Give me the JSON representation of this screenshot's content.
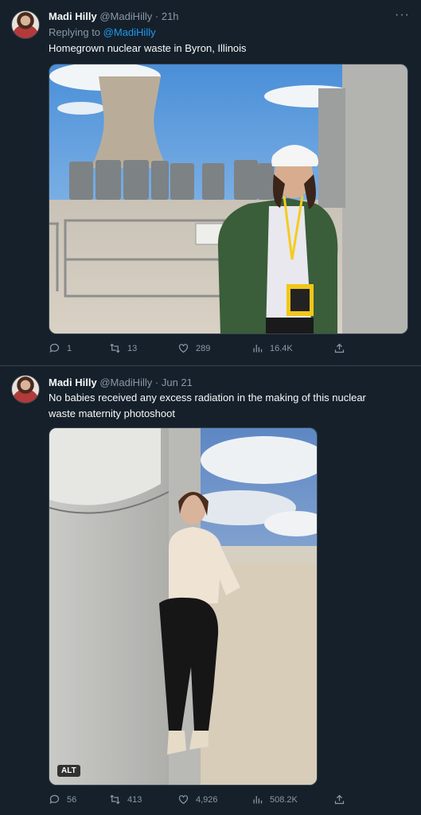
{
  "tweets": [
    {
      "name": "Madi Hilly",
      "handle": "@MadiHilly",
      "sep": "·",
      "time": "21h",
      "reply_prefix": "Replying to",
      "reply_to": "@MadiHilly",
      "text": "Homegrown nuclear waste in Byron, Illinois",
      "actions": {
        "replies": "1",
        "retweets": "13",
        "likes": "289",
        "views": "16.4K"
      }
    },
    {
      "name": "Madi Hilly",
      "handle": "@MadiHilly",
      "sep": "·",
      "time": "Jun 21",
      "text": "No babies received any excess radiation in the making of this nuclear waste maternity photoshoot",
      "alt_badge": "ALT",
      "actions": {
        "replies": "56",
        "retweets": "413",
        "likes": "4,926",
        "views": "508.2K"
      }
    }
  ],
  "more_icon": "···"
}
